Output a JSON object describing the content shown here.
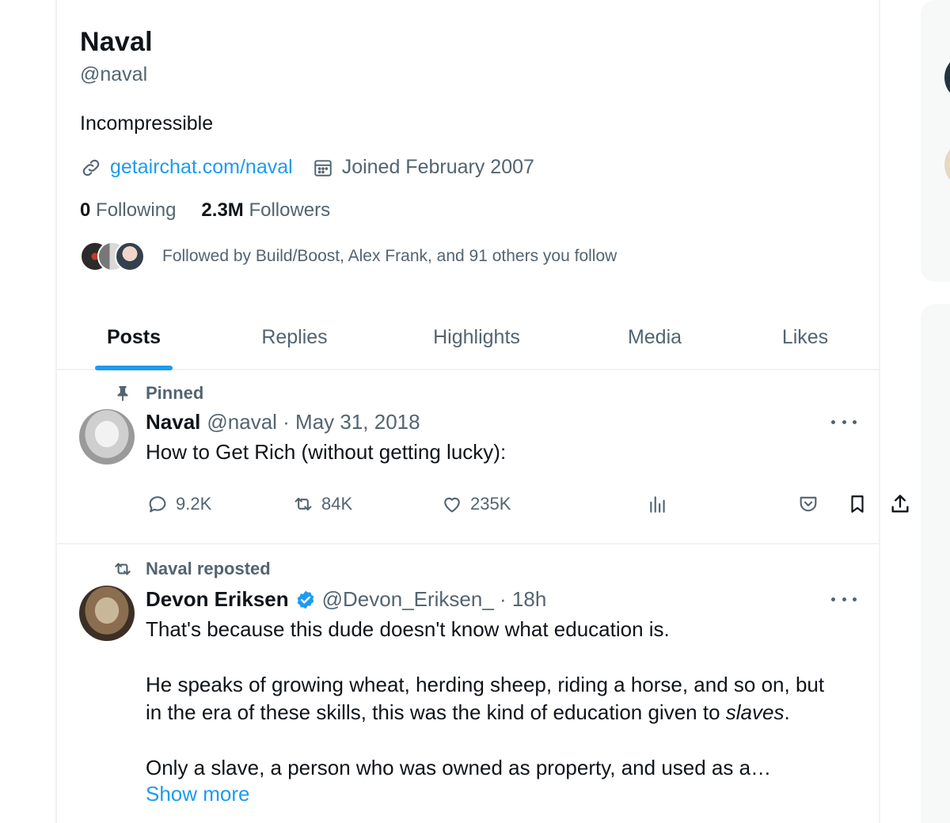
{
  "profile": {
    "name": "Naval",
    "handle": "@naval",
    "bio": "Incompressible",
    "website": "getairchat.com/naval",
    "joined": "Joined February 2007",
    "following_count": "0",
    "following_label": "Following",
    "followers_count": "2.3M",
    "followers_label": "Followers",
    "followed_by": "Followed by Build/Boost, Alex Frank, and 91 others you follow"
  },
  "tabs": [
    {
      "label": "Posts",
      "active": true
    },
    {
      "label": "Replies",
      "active": false
    },
    {
      "label": "Highlights",
      "active": false
    },
    {
      "label": "Media",
      "active": false
    },
    {
      "label": "Likes",
      "active": false
    }
  ],
  "posts": [
    {
      "social_context": "Pinned",
      "social_icon": "pin-icon",
      "author_name": "Naval",
      "author_handle": "@naval · May 31, 2018",
      "text": [
        "How to Get Rich (without getting lucky):"
      ],
      "replies": "9.2K",
      "reposts": "84K",
      "likes": "235K"
    },
    {
      "social_context": "Naval reposted",
      "social_icon": "repost-icon",
      "author_name": "Devon Eriksen",
      "verified": true,
      "author_handle": "@Devon_Eriksen_ · 18h",
      "text_line1": "That's because this dude doesn't know what education is.",
      "text_line2": "He speaks of growing wheat, herding sheep, riding a horse, and so on, but",
      "text_line3_prefix": "in the era of these skills, this was the kind of education given to ",
      "text_line3_emphasis": "slaves",
      "text_line3_suffix": ".",
      "text_line4": "Only a slave, a person who was owned as property, and used as a…",
      "show_more": "Show more"
    }
  ],
  "colors": {
    "accent": "#1d9bf0",
    "secondary_text": "#536471",
    "primary_text": "#0f1419",
    "border": "#eff3f4"
  }
}
